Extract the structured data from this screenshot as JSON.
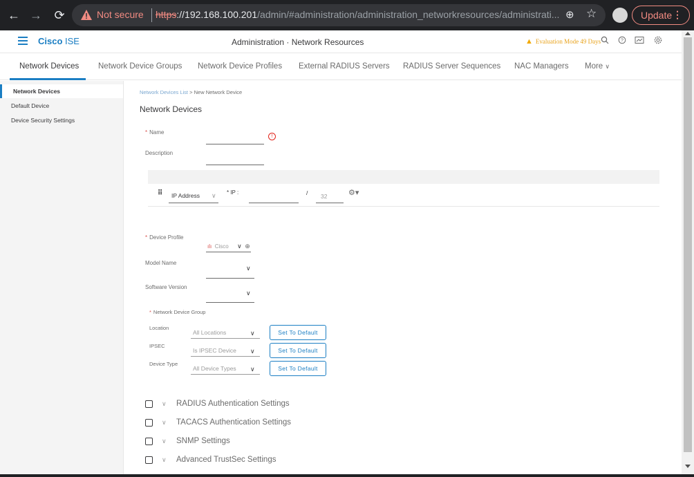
{
  "browser": {
    "security_label": "Not secure",
    "url_scheme": "https",
    "url_host": "://192.168.100.201",
    "url_path": "/admin/#administration/administration_networkresources/administrati...",
    "update_label": "Update",
    "icons": [
      "back-arrow-icon",
      "forward-arrow-icon",
      "reload-icon",
      "warning-icon",
      "zoom-icon",
      "star-icon",
      "profile-icon",
      "more-icon"
    ]
  },
  "header": {
    "brand_bold": "Cisco",
    "brand_light": " ISE",
    "title": "Administration · Network Resources",
    "eval_text": "Evaluation Mode 49 Days",
    "accent": "#1b7ec3",
    "warning_color": "#f2a900"
  },
  "tabs": [
    {
      "label": "Network Devices",
      "active": true
    },
    {
      "label": "Network Device Groups"
    },
    {
      "label": "Network Device Profiles"
    },
    {
      "label": "External RADIUS Servers"
    },
    {
      "label": "RADIUS Server Sequences"
    },
    {
      "label": "NAC Managers"
    },
    {
      "label": "More"
    }
  ],
  "sidebar": {
    "items": [
      {
        "label": "Network Devices",
        "active": true
      },
      {
        "label": "Default Device"
      },
      {
        "label": "Device Security Settings"
      }
    ]
  },
  "breadcrumb": {
    "parent": "Network Devices List",
    "separator": ">",
    "current": "New Network Device"
  },
  "form": {
    "section_title": "Network Devices",
    "name_label": "Name",
    "description_label": "Description",
    "ip_type": "IP Address",
    "ip_label": "* IP :",
    "ip_slash": "/",
    "ip_mask": "32",
    "device_profile_label": "Device Profile",
    "device_profile_value": "Cisco",
    "model_name_label": "Model Name",
    "software_version_label": "Software Version",
    "ndg_label": "Network Device Group",
    "ndg_rows": [
      {
        "label": "Location",
        "value": "All Locations",
        "button": "Set To Default"
      },
      {
        "label": "IPSEC",
        "value": "Is IPSEC Device",
        "button": "Set To Default"
      },
      {
        "label": "Device Type",
        "value": "All Device Types",
        "button": "Set To Default"
      }
    ]
  },
  "accordions": [
    {
      "label": "RADIUS Authentication Settings"
    },
    {
      "label": "TACACS Authentication Settings"
    },
    {
      "label": "SNMP Settings"
    },
    {
      "label": "Advanced TrustSec Settings"
    }
  ]
}
